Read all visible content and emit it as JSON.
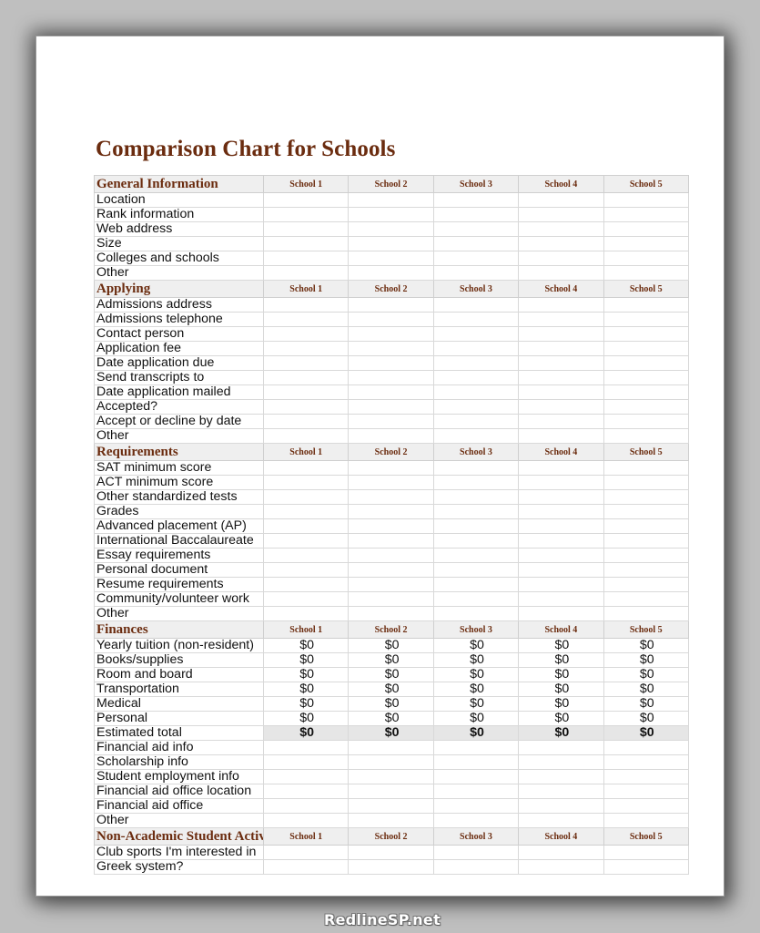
{
  "document": {
    "title": "Comparison Chart for Schools"
  },
  "schools": [
    "School 1",
    "School 2",
    "School 3",
    "School 4",
    "School 5"
  ],
  "sections": [
    {
      "title": "General Information",
      "rows": [
        {
          "label": "Location"
        },
        {
          "label": "Rank information"
        },
        {
          "label": "Web address"
        },
        {
          "label": "Size"
        },
        {
          "label": "Colleges and schools"
        },
        {
          "label": "Other"
        }
      ]
    },
    {
      "title": "Applying",
      "rows": [
        {
          "label": "Admissions address"
        },
        {
          "label": "Admissions telephone"
        },
        {
          "label": "Contact person"
        },
        {
          "label": "Application fee"
        },
        {
          "label": "Date application due"
        },
        {
          "label": "Send transcripts to"
        },
        {
          "label": "Date application mailed"
        },
        {
          "label": "Accepted?"
        },
        {
          "label": "Accept or decline by date"
        },
        {
          "label": "Other"
        }
      ]
    },
    {
      "title": "Requirements",
      "rows": [
        {
          "label": "SAT minimum score"
        },
        {
          "label": "ACT minimum score"
        },
        {
          "label": "Other standardized tests"
        },
        {
          "label": "Grades"
        },
        {
          "label": "Advanced placement (AP)"
        },
        {
          "label": "International Baccalaureate"
        },
        {
          "label": "Essay requirements"
        },
        {
          "label": "Personal document"
        },
        {
          "label": "Resume requirements"
        },
        {
          "label": "Community/volunteer work"
        },
        {
          "label": "Other"
        }
      ]
    },
    {
      "title": "Finances",
      "rows": [
        {
          "label": "Yearly tuition (non-resident)",
          "values": [
            "$0",
            "$0",
            "$0",
            "$0",
            "$0"
          ]
        },
        {
          "label": "Books/supplies",
          "values": [
            "$0",
            "$0",
            "$0",
            "$0",
            "$0"
          ]
        },
        {
          "label": "Room and board",
          "values": [
            "$0",
            "$0",
            "$0",
            "$0",
            "$0"
          ]
        },
        {
          "label": "Transportation",
          "values": [
            "$0",
            "$0",
            "$0",
            "$0",
            "$0"
          ]
        },
        {
          "label": "Medical",
          "values": [
            "$0",
            "$0",
            "$0",
            "$0",
            "$0"
          ]
        },
        {
          "label": "Personal",
          "values": [
            "$0",
            "$0",
            "$0",
            "$0",
            "$0"
          ]
        },
        {
          "label": "Estimated total",
          "values": [
            "$0",
            "$0",
            "$0",
            "$0",
            "$0"
          ],
          "total": true
        },
        {
          "label": "Financial aid info"
        },
        {
          "label": "Scholarship info"
        },
        {
          "label": "Student employment info"
        },
        {
          "label": "Financial aid office location"
        },
        {
          "label": "Financial aid office"
        },
        {
          "label": "Other"
        }
      ]
    },
    {
      "title": "Non-Academic Student Activities",
      "rows": [
        {
          "label": "Club sports I'm interested in"
        },
        {
          "label": "Greek system?"
        }
      ]
    }
  ],
  "watermark": "RedlineSP.net"
}
